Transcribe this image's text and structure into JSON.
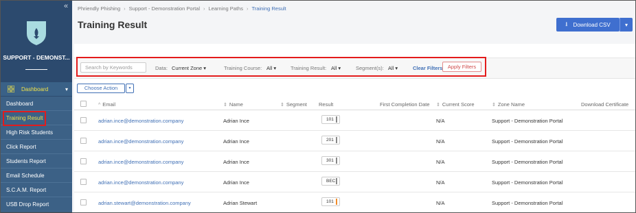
{
  "sidebar": {
    "collapse_icon": "double-chevron-left-icon",
    "logo_icon": "shield-fish-icon",
    "org_name": "SUPPORT - DEMONST...",
    "section_label": "Dashboard",
    "items": [
      {
        "label": "Dashboard"
      },
      {
        "label": "Training Result"
      },
      {
        "label": "High Risk Students"
      },
      {
        "label": "Click Report"
      },
      {
        "label": "Students Report"
      },
      {
        "label": "Email Schedule"
      },
      {
        "label": "S.C.A.M. Report"
      },
      {
        "label": "USB Drop Report"
      }
    ]
  },
  "breadcrumb": {
    "items": [
      "Phriendly Phishing",
      "Support - Demonstration Portal",
      "Learning Paths",
      "Training Result"
    ]
  },
  "page_title": "Training Result",
  "download_button": {
    "label": "Download CSV",
    "icon": "download-icon"
  },
  "filters": {
    "search_placeholder": "Search by Keywords",
    "data_label": "Data:",
    "data_value": "Current Zone",
    "course_label": "Training Course:",
    "course_value": "All",
    "result_label": "Training Result:",
    "result_value": "All",
    "segment_label": "Segment(s):",
    "segment_value": "All",
    "clear_label": "Clear Filters",
    "apply_label": "Apply Filters"
  },
  "choose_action": "Choose Action",
  "table": {
    "headers": [
      "Email",
      "Name",
      "Segment",
      "Result",
      "First Completion Date",
      "Current Score",
      "Zone Name",
      "Download Certificate"
    ],
    "rows": [
      {
        "email": "adrian.ince@demonstration.company",
        "name": "Adrian Ince",
        "segment": "",
        "result": "101",
        "first_completion": "",
        "score": "N/A",
        "zone": "Support - Demonstration Portal"
      },
      {
        "email": "adrian.ince@demonstration.company",
        "name": "Adrian Ince",
        "segment": "",
        "result": "201",
        "first_completion": "",
        "score": "N/A",
        "zone": "Support - Demonstration Portal"
      },
      {
        "email": "adrian.ince@demonstration.company",
        "name": "Adrian Ince",
        "segment": "",
        "result": "301",
        "first_completion": "",
        "score": "N/A",
        "zone": "Support - Demonstration Portal"
      },
      {
        "email": "adrian.ince@demonstration.company",
        "name": "Adrian Ince",
        "segment": "",
        "result": "BEC",
        "first_completion": "",
        "score": "N/A",
        "zone": "Support - Demonstration Portal"
      },
      {
        "email": "adrian.stewart@demonstration.company",
        "name": "Adrian Stewart",
        "segment": "",
        "result": "101",
        "first_completion": "",
        "score": "N/A",
        "zone": "Support - Demonstration Portal"
      }
    ]
  },
  "colors": {
    "sidebar": "#2c4a6e",
    "accent": "#3f6fcf",
    "highlight_box": "#e31b1b",
    "active_nav_text": "#f0e24a"
  }
}
